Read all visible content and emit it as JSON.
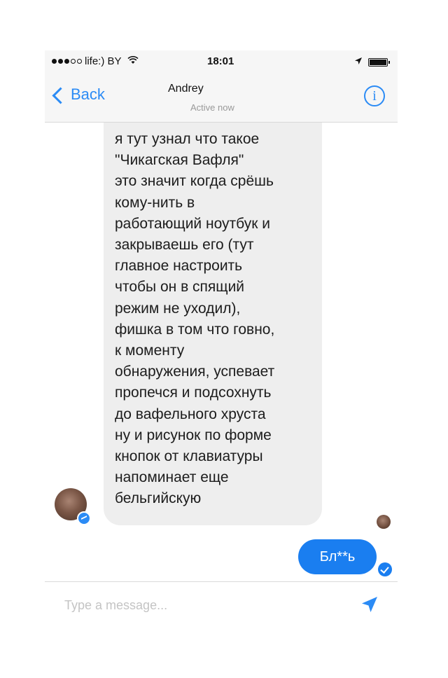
{
  "status_bar": {
    "carrier": "life:) BY",
    "time": "18:01",
    "signal_bars_filled": 3,
    "signal_bars_total": 5
  },
  "header": {
    "back_label": "Back",
    "contact_name": "Andrey",
    "contact_status": "Active now",
    "info_label": "i"
  },
  "messages": {
    "incoming_text": "я тут узнал что такое\n\"Чикагская Вафля\"\nэто значит когда срёшь\nкому-нить в\nработающий ноутбук и\nзакрываешь его (тут\nглавное настроить\nчтобы он в спящий\nрежим не уходил),\nфишка в том что говно,\nк моменту\nобнаружения, успевает\nпропечся и подсохнуть\nдо вафельного хруста\nну и рисунок по форме\nкнопок от клавиатуры\nнапоминает еще\nбельгийскую",
    "outgoing_text": "Бл**ь"
  },
  "composer": {
    "placeholder": "Type a message..."
  },
  "colors": {
    "accent": "#2b8bf5",
    "outgoing_bubble": "#1a7ef0",
    "incoming_bubble": "#eeeeee"
  }
}
